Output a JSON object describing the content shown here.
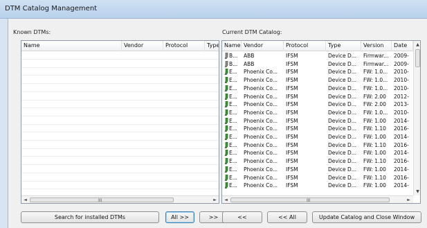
{
  "window": {
    "title": "DTM Catalog Management"
  },
  "known": {
    "label": "Known DTMs:",
    "columns": [
      "Name",
      "Vendor",
      "Protocol",
      "Type"
    ],
    "scroll_grip": "III"
  },
  "current": {
    "label": "Current DTM Catalog:",
    "columns": [
      "Name",
      "Vendor",
      "Protocol",
      "Type",
      "Version",
      "Date"
    ],
    "scroll_grip": "III",
    "rows": [
      {
        "icon": "device-icon",
        "name": "B...",
        "vendor": "ABB",
        "protocol": "IFSM",
        "type": "Device D...",
        "version": "Firmwar...",
        "date": "2009-"
      },
      {
        "icon": "device-icon",
        "name": "B...",
        "vendor": "ABB",
        "protocol": "IFSM",
        "type": "Device D...",
        "version": "Firmwar...",
        "date": "2009-"
      },
      {
        "icon": "green-device-icon",
        "name": "E...",
        "vendor": "Phoenix Co...",
        "protocol": "IFSM",
        "type": "Device D...",
        "version": "FW: 1.0...",
        "date": "2010-"
      },
      {
        "icon": "green-device-icon",
        "name": "E...",
        "vendor": "Phoenix Co...",
        "protocol": "IFSM",
        "type": "Device D...",
        "version": "FW: 1.0...",
        "date": "2010-"
      },
      {
        "icon": "green-device-icon",
        "name": "E...",
        "vendor": "Phoenix Co...",
        "protocol": "IFSM",
        "type": "Device D...",
        "version": "FW: 1.0...",
        "date": "2010-"
      },
      {
        "icon": "green-device-icon",
        "name": "E...",
        "vendor": "Phoenix Co...",
        "protocol": "IFSM",
        "type": "Device D...",
        "version": "FW: 2.00",
        "date": "2012-"
      },
      {
        "icon": "green-device-icon",
        "name": "E...",
        "vendor": "Phoenix Co...",
        "protocol": "IFSM",
        "type": "Device D...",
        "version": "FW: 2.00",
        "date": "2013-"
      },
      {
        "icon": "green-device-icon",
        "name": "E...",
        "vendor": "Phoenix Co...",
        "protocol": "IFSM",
        "type": "Device D...",
        "version": "FW: 1.0...",
        "date": "2010-"
      },
      {
        "icon": "green-device-icon",
        "name": "E...",
        "vendor": "Phoenix Co...",
        "protocol": "IFSM",
        "type": "Device D...",
        "version": "FW: 1.00",
        "date": "2014-"
      },
      {
        "icon": "green-device-icon",
        "name": "E...",
        "vendor": "Phoenix Co...",
        "protocol": "IFSM",
        "type": "Device D...",
        "version": "FW: 1.10",
        "date": "2016-"
      },
      {
        "icon": "green-device-icon",
        "name": "E...",
        "vendor": "Phoenix Co...",
        "protocol": "IFSM",
        "type": "Device D...",
        "version": "FW: 1.00",
        "date": "2014-"
      },
      {
        "icon": "green-device-icon",
        "name": "E...",
        "vendor": "Phoenix Co...",
        "protocol": "IFSM",
        "type": "Device D...",
        "version": "FW: 1.10",
        "date": "2016-"
      },
      {
        "icon": "green-device-icon",
        "name": "E...",
        "vendor": "Phoenix Co...",
        "protocol": "IFSM",
        "type": "Device D...",
        "version": "FW: 1.00",
        "date": "2014-"
      },
      {
        "icon": "green-device-icon",
        "name": "E...",
        "vendor": "Phoenix Co...",
        "protocol": "IFSM",
        "type": "Device D...",
        "version": "FW: 1.10",
        "date": "2016-"
      },
      {
        "icon": "green-device-icon",
        "name": "E...",
        "vendor": "Phoenix Co...",
        "protocol": "IFSM",
        "type": "Device D...",
        "version": "FW: 1.00",
        "date": "2014-"
      },
      {
        "icon": "green-device-icon",
        "name": "E...",
        "vendor": "Phoenix Co...",
        "protocol": "IFSM",
        "type": "Device D...",
        "version": "FW: 1.10",
        "date": "2016-"
      },
      {
        "icon": "green-device-icon",
        "name": "E...",
        "vendor": "Phoenix Co...",
        "protocol": "IFSM",
        "type": "Device D...",
        "version": "FW: 1.00",
        "date": "2014-"
      }
    ]
  },
  "buttons": {
    "search": "Search for installed DTMs",
    "all_right": "All >>",
    "right": ">>",
    "left": "<<",
    "all_left": "<< All",
    "update": "Update Catalog and Close Window"
  },
  "icons": {
    "scroll_left": "◄",
    "scroll_right": "►",
    "scroll_up": "▲",
    "scroll_down": "▼"
  }
}
